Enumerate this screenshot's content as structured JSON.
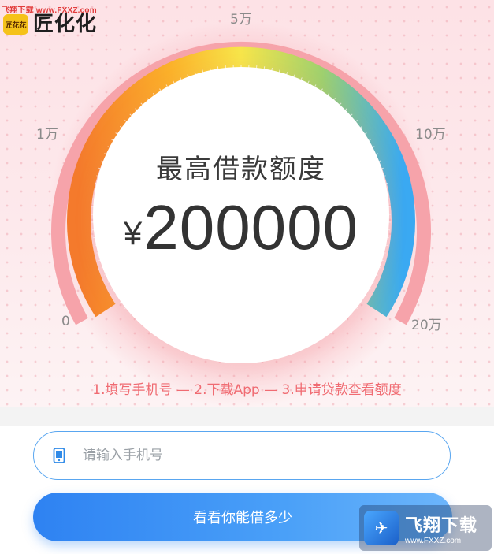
{
  "watermark_top": "飞翔下载 www.FXXZ.com",
  "brand": {
    "badge_text": "匠花花",
    "name": "匠化化",
    "accent": "#f5c21a"
  },
  "gauge": {
    "scale_labels": [
      "0",
      "1万",
      "5万",
      "10万",
      "20万"
    ],
    "title": "最高借款额度",
    "currency": "¥",
    "amount": "200000",
    "gradient_colors": [
      "#f47a2c",
      "#fbc02d",
      "#f7e54a",
      "#9fd06e",
      "#3aa9f2"
    ],
    "pointer_color": "#f36b57"
  },
  "steps_text": "1.填写手机号 — 2.下载App — 3.申请贷款查看额度",
  "form": {
    "phone_placeholder": "请输入手机号",
    "submit_label": "看看你能借多少"
  },
  "watermark_corner": {
    "title": "飞翔下载",
    "url": "www.FXXZ.com"
  }
}
